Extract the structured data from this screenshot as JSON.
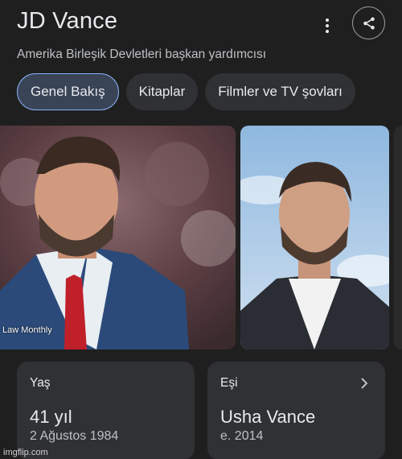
{
  "header": {
    "title": "JD Vance",
    "subtitle": "Amerika Birleşik Devletleri başkan yardımcısı",
    "more_icon": "more-vert-icon",
    "share_icon": "share-icon"
  },
  "tabs": [
    {
      "label": "Genel Bakış",
      "active": true
    },
    {
      "label": "Kitaplar",
      "active": false
    },
    {
      "label": "Filmler ve TV şovları",
      "active": false
    }
  ],
  "images": {
    "credit": "Law Monthly"
  },
  "cards": [
    {
      "label": "Yaş",
      "value": "41 yıl",
      "sub": "2 Ağustos 1984"
    },
    {
      "label": "Eşi",
      "value": "Usha Vance",
      "sub": "e. 2014",
      "icon": "chevron-right-icon"
    }
  ],
  "watermark": "imgflip.com",
  "colors": {
    "background": "#1f1f1f",
    "card": "#303134",
    "accent": "#8ab4f8"
  }
}
